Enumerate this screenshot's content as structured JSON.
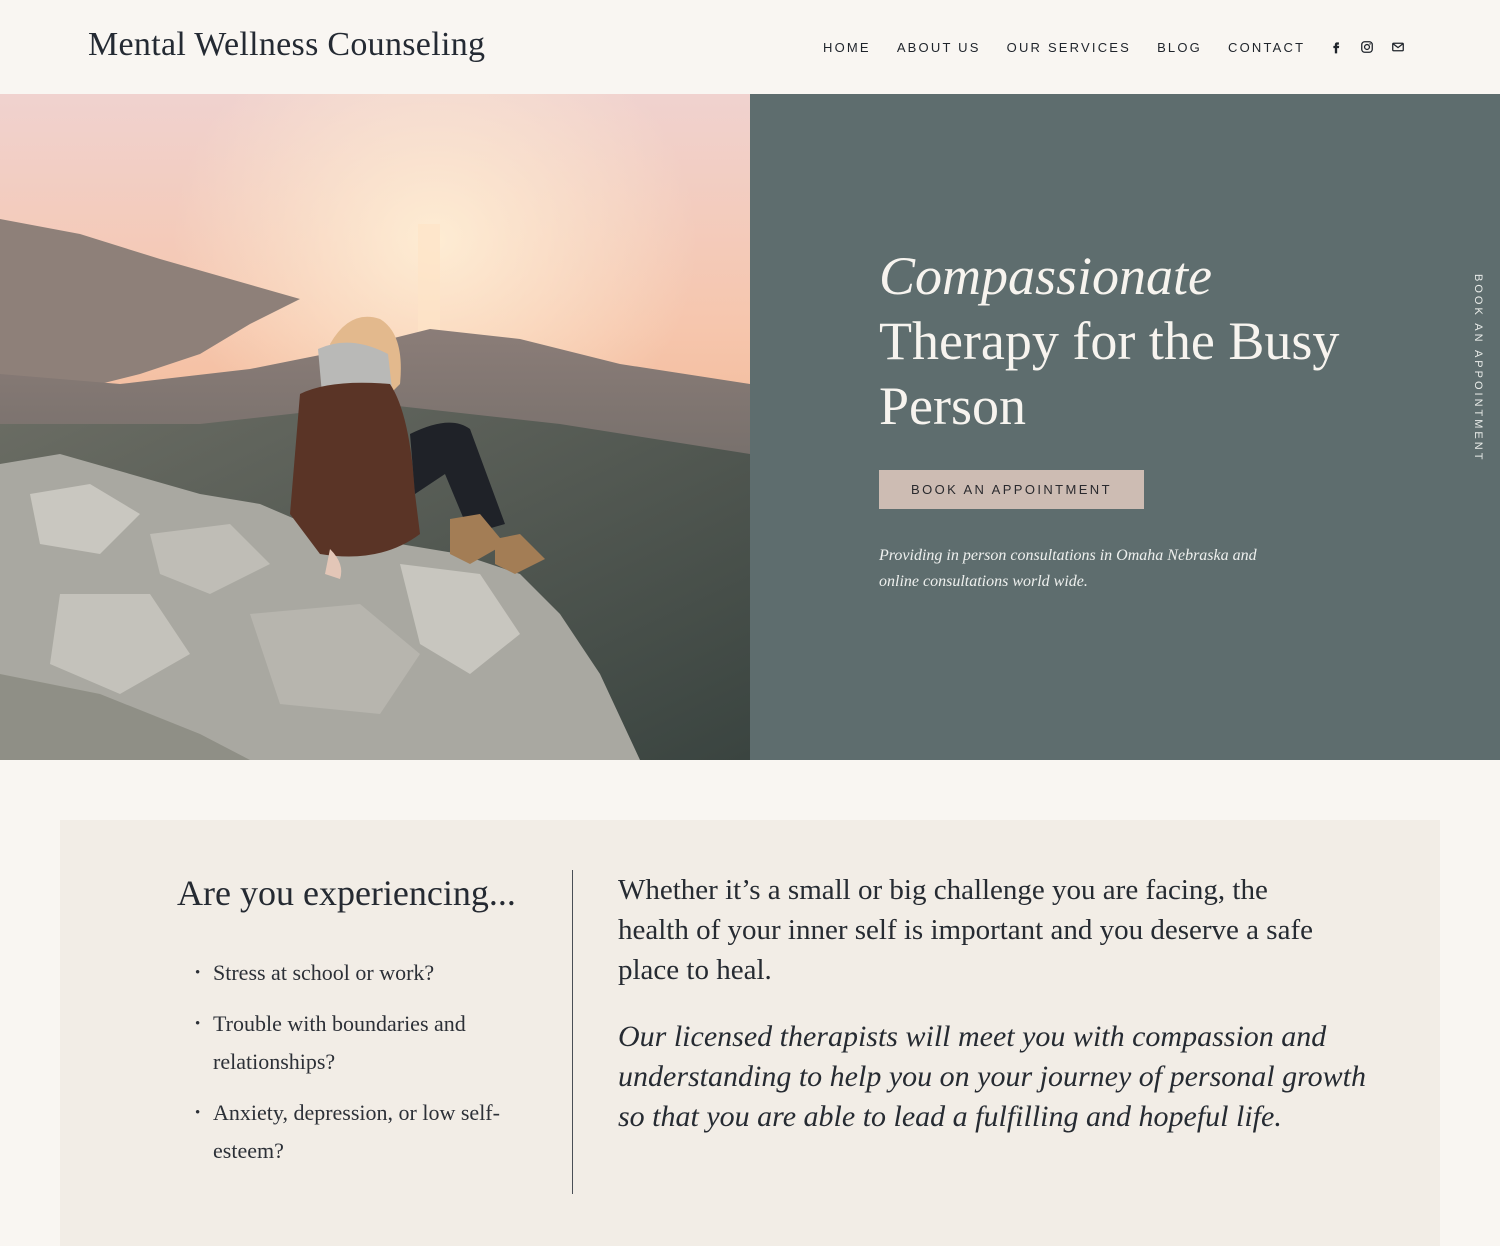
{
  "header": {
    "brand": "Mental Wellness Counseling",
    "nav": [
      "HOME",
      "ABOUT US",
      "OUR SERVICES",
      "BLOG",
      "CONTACT"
    ],
    "social_icons": [
      "facebook-icon",
      "instagram-icon",
      "email-icon"
    ]
  },
  "hero": {
    "title_italic": "Compassionate",
    "title_rest": "Therapy for the Busy Person",
    "cta_label": "BOOK AN APPOINTMENT",
    "note": "Providing in person consultations in Omaha Nebraska and online consultations world wide.",
    "side_link": "BOOK AN APPOINTMENT",
    "panel_color": "#5e6d6e",
    "cta_color": "#cdbcb3"
  },
  "intro": {
    "heading": "Are you experiencing...",
    "items": [
      "Stress at school or work?",
      "Trouble with boundaries and relationships?",
      "Anxiety, depression, or low self-esteem?"
    ],
    "lead": "Whether it’s a small or big challenge you are facing, the health of your inner self is important and you deserve a safe place to heal.",
    "italic": "Our licensed therapists will meet you with compassion and understanding to help you on your journey of personal growth so that you are able to lead a fulfilling and hopeful life."
  }
}
